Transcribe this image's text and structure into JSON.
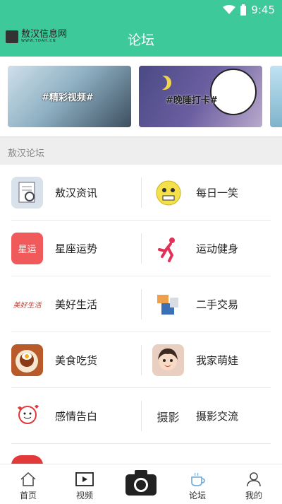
{
  "status": {
    "time": "9:45"
  },
  "header": {
    "logo_text": "敖汉信息网",
    "logo_sub": "WWW.TOAH.CN",
    "title": "论坛"
  },
  "banners": [
    {
      "label": "#精彩视频#"
    },
    {
      "label": "#晚睡打卡#"
    }
  ],
  "section": {
    "title": "敖汉论坛"
  },
  "forums": [
    {
      "left": {
        "label": "敖汉资讯",
        "icon": "newspaper-icon",
        "color": "#d9e2ea"
      },
      "right": {
        "label": "每日一笑",
        "icon": "smiley-icon",
        "color": "#fff4c0"
      }
    },
    {
      "left": {
        "label": "星座运势",
        "icon": "constellation-icon",
        "icon_text": "星运",
        "color": "#f05a5a"
      },
      "right": {
        "label": "运动健身",
        "icon": "runner-icon",
        "color": "#f7e3ea"
      }
    },
    {
      "left": {
        "label": "美好生活",
        "icon": "good-life-icon",
        "icon_text": "美好生活",
        "color": "#ffffff"
      },
      "right": {
        "label": "二手交易",
        "icon": "trade-icon",
        "color": "#eef3f8"
      }
    },
    {
      "left": {
        "label": "美食吃货",
        "icon": "food-icon",
        "color": "#b85a2a"
      },
      "right": {
        "label": "我家萌娃",
        "icon": "baby-icon",
        "color": "#e8cfc2"
      }
    },
    {
      "left": {
        "label": "感情告白",
        "icon": "heart-icon",
        "color": "#fdeff0"
      },
      "right": {
        "label": "摄影交流",
        "icon": "photo-icon",
        "icon_text": "摄影",
        "color": "#ffffff"
      }
    }
  ],
  "tabs": [
    {
      "label": "首页",
      "icon": "home-icon"
    },
    {
      "label": "视频",
      "icon": "video-icon"
    },
    {
      "label": "",
      "icon": "camera-icon"
    },
    {
      "label": "论坛",
      "icon": "coffee-icon"
    },
    {
      "label": "我的",
      "icon": "user-icon"
    }
  ]
}
